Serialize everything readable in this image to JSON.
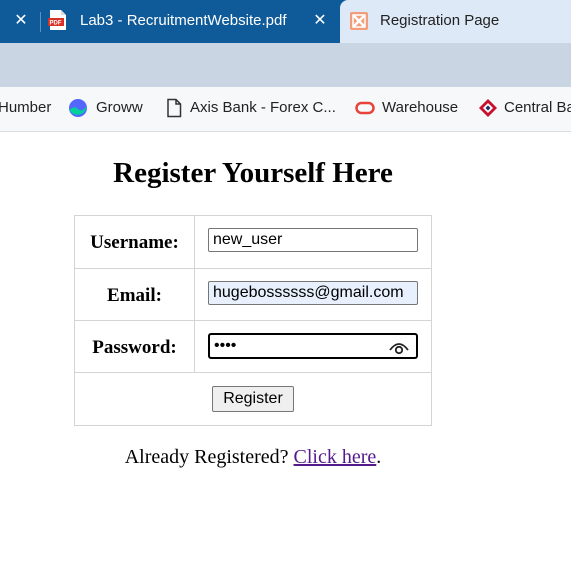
{
  "tabs": [
    {
      "title": "Lab3 - RecruitmentWebsite.pdf",
      "icon": "pdf-icon",
      "active": false
    },
    {
      "title": "Registration Page",
      "icon": "xampp-icon",
      "active": true
    }
  ],
  "bookmarks": [
    {
      "label": "Humber",
      "icon": "humber-icon"
    },
    {
      "label": "Groww",
      "icon": "groww-icon"
    },
    {
      "label": "Axis Bank - Forex C...",
      "icon": "document-icon"
    },
    {
      "label": "Warehouse",
      "icon": "oracle-icon"
    },
    {
      "label": "Central Ba",
      "icon": "central-bank-icon"
    }
  ],
  "page": {
    "heading": "Register Yourself Here",
    "form": {
      "username_label": "Username:",
      "username_value": "new_user",
      "email_label": "Email:",
      "email_value": "hugebossssss@gmail.com",
      "password_label": "Password:",
      "password_value": "••••",
      "submit_label": "Register"
    },
    "footer": {
      "text": "Already Registered?",
      "link": "Click here",
      "suffix": "."
    }
  },
  "colors": {
    "tab_strip": "#0f5a99",
    "active_tab": "#dde9f6",
    "visited_link": "#551a8b",
    "autofill_bg": "#e8f0fe"
  }
}
